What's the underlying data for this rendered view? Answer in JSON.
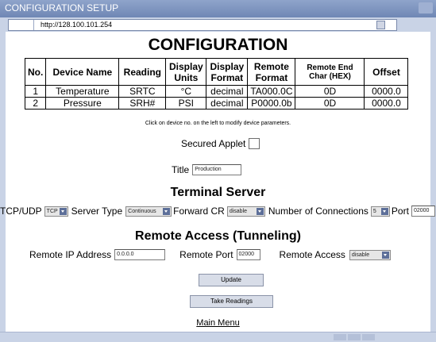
{
  "window": {
    "title": "CONFIGURATION SETUP"
  },
  "address": {
    "url": "http://128.100.101.254"
  },
  "page": {
    "heading": "CONFIGURATION",
    "table": {
      "headers": [
        "No.",
        "Device Name",
        "Reading",
        "Display Units",
        "Display Format",
        "Remote Format",
        "Remote End Char (HEX)",
        "Offset"
      ],
      "rows": [
        [
          "1",
          "Temperature",
          "SRTC",
          "°C",
          "decimal",
          "TA000.0C",
          "0D",
          "0000.0"
        ],
        [
          "2",
          "Pressure",
          "SRH#",
          "PSI",
          "decimal",
          "P0000.0b",
          "0D",
          "0000.0"
        ]
      ]
    },
    "note": "Click on device no. on the left to modify device parameters.",
    "secured_applet_label": "Secured Applet",
    "title_label": "Title",
    "title_value": "Production",
    "terminal_heading": "Terminal Server",
    "tcp_label": "TCP/UDP",
    "tcp_value": "TCP",
    "server_type_label": "Server Type",
    "server_type_value": "Continuous",
    "forward_cr_label": "Forward CR",
    "forward_cr_value": "disable",
    "connections_label": "Number of Connections",
    "connections_value": "5",
    "port_label": "Port",
    "port_value": "02000",
    "remote_heading": "Remote Access (Tunneling)",
    "remote_ip_label": "Remote IP Address",
    "remote_ip_value": "0.0.0.0",
    "remote_port_label": "Remote Port",
    "remote_port_value": "02000",
    "remote_access_label": "Remote Access",
    "remote_access_value": "disable",
    "update_button": "Update",
    "take_readings_button": "Take Readings",
    "main_menu_link": "Main Menu"
  },
  "colors": {
    "window_bg": "#c9d3e6",
    "titlebar": "#7a90bd",
    "select_arrow": "#5d6f99"
  }
}
